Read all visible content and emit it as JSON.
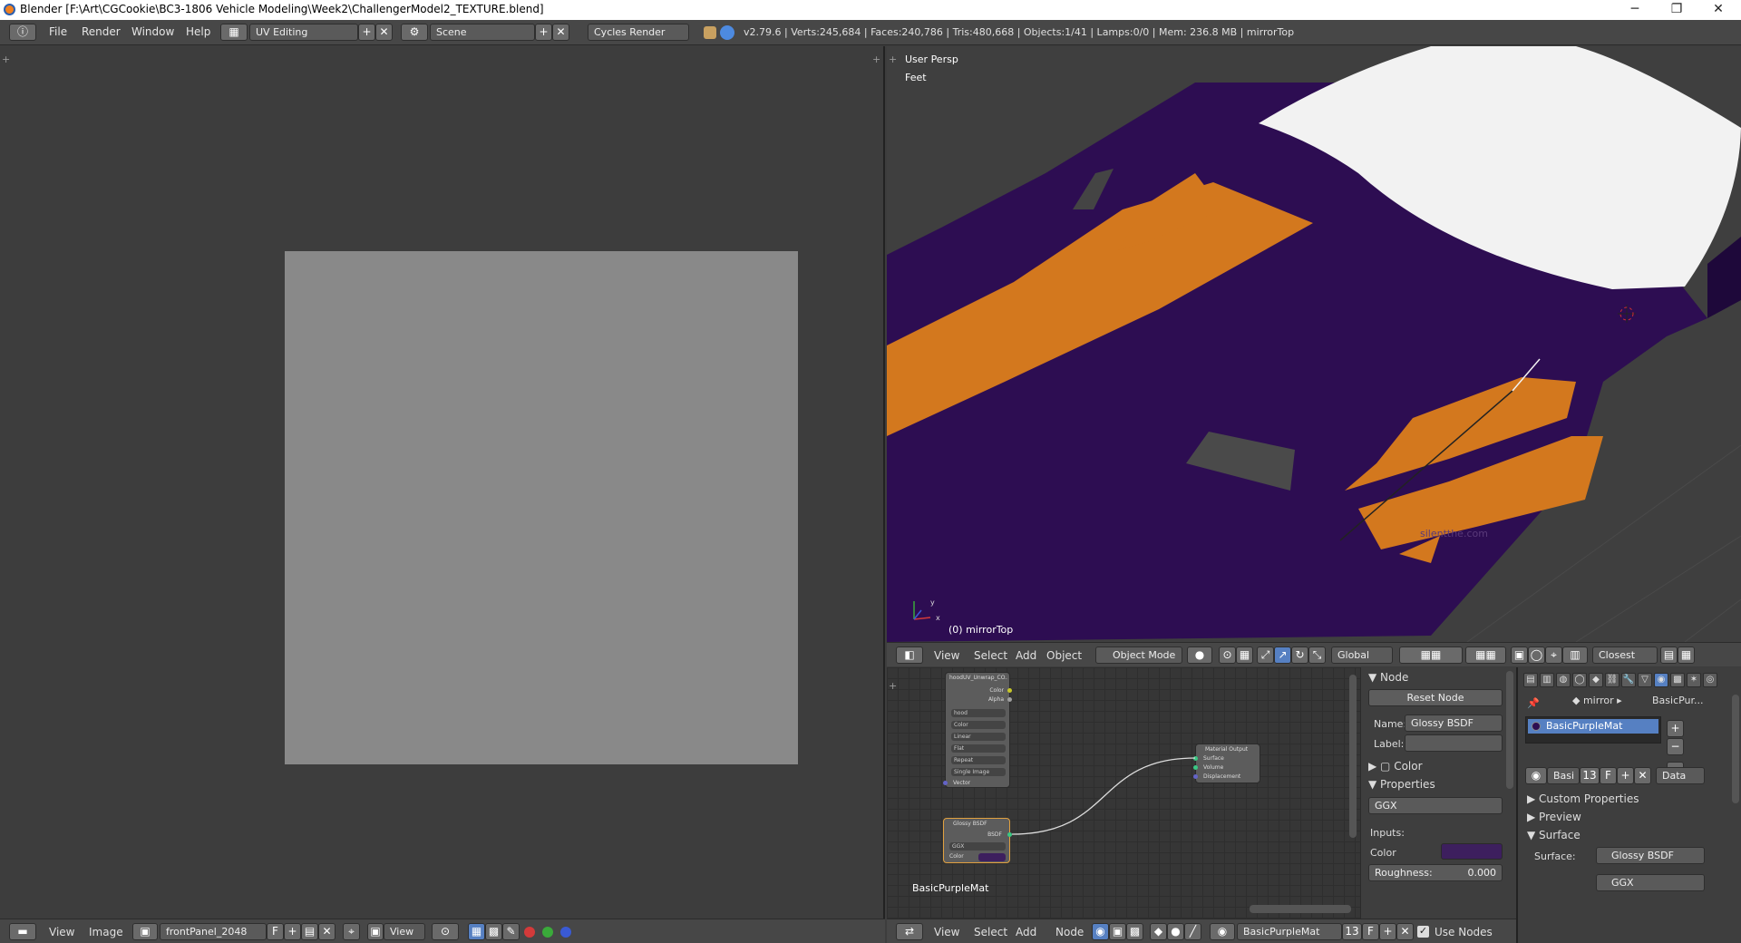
{
  "window": {
    "title": "Blender [F:\\Art\\CGCookie\\BC3-1806 Vehicle Modeling\\Week2\\ChallengerModel2_TEXTURE.blend]",
    "minimize": "─",
    "maximize": "❐",
    "close": "✕"
  },
  "info": {
    "menus": [
      "File",
      "Render",
      "Window",
      "Help"
    ],
    "layout": "UV Editing",
    "scene": "Scene",
    "engine": "Cycles Render",
    "stats": "v2.79.6 | Verts:245,684 | Faces:240,786 | Tris:480,668 | Objects:1/41 | Lamps:0/0 | Mem: 236.8 MB | mirrorTop"
  },
  "uv_header": {
    "view": "View",
    "image": "Image",
    "image_name": "frontPanel_2048",
    "fake_user": "F",
    "view_dropdown": "View"
  },
  "viewport": {
    "persp": "User Persp",
    "units": "Feet",
    "object_label": "(0) mirrorTop",
    "watermark": "silentthe.com",
    "axis_y": "y",
    "axis_x": "x"
  },
  "viewport_header": {
    "view": "View",
    "select": "Select",
    "add": "Add",
    "object": "Object",
    "mode": "Object Mode",
    "orientation": "Global",
    "snap": "Closest"
  },
  "node_side": {
    "node_title": "Node",
    "reset": "Reset Node",
    "name_label": "Name:",
    "name_value": "Glossy BSDF",
    "label_label": "Label:",
    "label_value": "",
    "color_panel": "Color",
    "properties_panel": "Properties",
    "distribution": "GGX",
    "inputs_label": "Inputs:",
    "color_label": "Color",
    "roughness_label": "Roughness:",
    "roughness_value": "0.000",
    "purple": "#3d1f5e"
  },
  "nodes": {
    "image_node_title": "hoodUV_Unwrap_CO...",
    "image_out_color": "Color",
    "image_out_alpha": "Alpha",
    "image_name_field": "hood",
    "image_opts": [
      "Color",
      "Linear",
      "Flat",
      "Repeat",
      "Single Image"
    ],
    "image_in_vector": "Vector",
    "glossy_title": "Glossy BSDF",
    "glossy_out": "BSDF",
    "glossy_dist": "GGX",
    "glossy_color_label": "Color",
    "output_title": "Material Output",
    "output_surface": "Surface",
    "output_volume": "Volume",
    "output_disp": "Displacement",
    "material_label": "BasicPurpleMat"
  },
  "node_header": {
    "view": "View",
    "select": "Select",
    "add": "Add",
    "node": "Node",
    "material": "BasicPurpleMat",
    "users": "13",
    "fake": "F",
    "use_nodes": "Use Nodes"
  },
  "properties": {
    "crumb_obj": "mirror",
    "crumb_mat": "BasicPur...",
    "slot": "BasicPurpleMat",
    "mat_short": "Basi",
    "mat_users": "13",
    "mat_fake": "F",
    "link": "Data",
    "custom_props": "Custom Properties",
    "preview": "Preview",
    "surface": "Surface",
    "surface_label": "Surface:",
    "surface_value": "Glossy BSDF",
    "dist": "GGX"
  },
  "colors": {
    "purple": "#2d0d52",
    "orange": "#d3781e",
    "white": "#f2f2f2",
    "accent": "#5680c2"
  }
}
